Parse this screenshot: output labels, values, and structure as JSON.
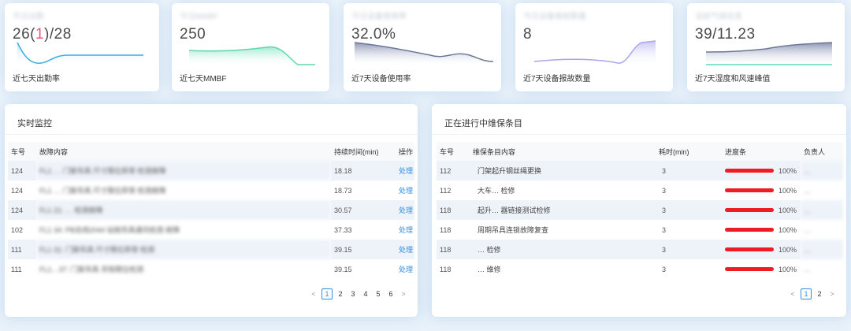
{
  "kpis": [
    {
      "title": "今日出勤",
      "value_a": "26(",
      "value_hl": "1",
      "value_b": ")/28",
      "caption": "近七天出勤率"
    },
    {
      "title": "今日MMBF",
      "value_a": "250",
      "value_hl": "",
      "value_b": "",
      "caption": "近七天MMBF"
    },
    {
      "title": "今日设备使用率",
      "value_a": "32.0%",
      "value_hl": "",
      "value_b": "",
      "caption": "近7天设备使用率"
    },
    {
      "title": "今日设备报故数量",
      "value_a": "8",
      "value_hl": "",
      "value_b": "",
      "caption": "近7天设备报故数量"
    },
    {
      "title": "当前气候信息",
      "value_a": "39/11.23",
      "value_hl": "",
      "value_b": "",
      "caption": "近7天湿度和风速峰值"
    }
  ],
  "monitor": {
    "title": "实时监控",
    "headers": [
      "车号",
      "故障内容",
      "持续时间(min)",
      "操作"
    ],
    "rows": [
      {
        "car": "124",
        "content": "FL1 … 门架吊具 尺寸限位异常 检测故障",
        "duration": "18.18",
        "action": "处理"
      },
      {
        "car": "124",
        "content": "FL1 … 门架吊具 尺寸限位异常 检测故障",
        "duration": "18.73",
        "action": "处理"
      },
      {
        "car": "124",
        "content": "FL1 21: … 检测故障",
        "duration": "30.57",
        "action": "处理"
      },
      {
        "car": "102",
        "content": "FL1 34: PB总线2044 站侧吊具通讯检测 故障",
        "duration": "37.33",
        "action": "处理"
      },
      {
        "car": "111",
        "content": "FL1 31: 门架吊具 尺寸限位异常 检测",
        "duration": "39.15",
        "action": "处理"
      },
      {
        "car": "111",
        "content": "FL1…37: 门架吊具 吊钩限位检测",
        "duration": "39.15",
        "action": "处理"
      }
    ],
    "pages": [
      "1",
      "2",
      "3",
      "4",
      "5",
      "6"
    ],
    "prev": "<",
    "next": ">"
  },
  "maint": {
    "title": "正在进行中维保条目",
    "headers": [
      "车号",
      "维保条目内容",
      "耗时(min)",
      "进度条",
      "负责人"
    ],
    "rows": [
      {
        "car": "112",
        "content": "门架起升钢丝绳更换",
        "time": "3",
        "progress": 100,
        "pct": "100%",
        "owner": "…"
      },
      {
        "car": "112",
        "content": "大车… 检修",
        "time": "3",
        "progress": 100,
        "pct": "100%",
        "owner": "…"
      },
      {
        "car": "118",
        "content": "起升… 器链接测试检修",
        "time": "3",
        "progress": 100,
        "pct": "100%",
        "owner": "…"
      },
      {
        "car": "118",
        "content": "周期吊具连锁故障复查",
        "time": "3",
        "progress": 100,
        "pct": "100%",
        "owner": "…"
      },
      {
        "car": "118",
        "content": "… 检修",
        "time": "3",
        "progress": 100,
        "pct": "100%",
        "owner": "…"
      },
      {
        "car": "118",
        "content": "… 维修",
        "time": "3",
        "progress": 100,
        "pct": "100%",
        "owner": "…"
      }
    ],
    "pages": [
      "1",
      "2"
    ],
    "prev": "<",
    "next": ">"
  }
}
